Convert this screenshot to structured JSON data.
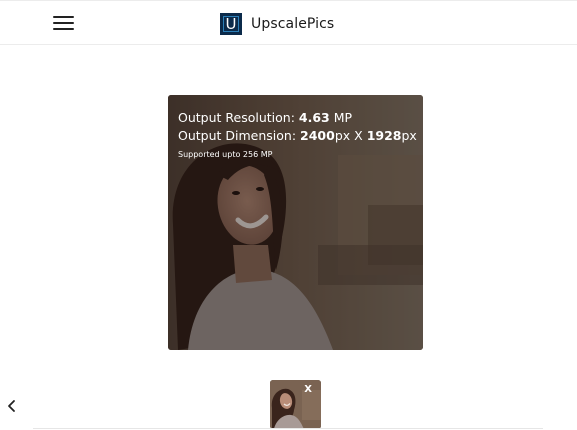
{
  "header": {
    "brand_letter": "U",
    "brand_name": "UpscalePics",
    "menu_icon": "hamburger-menu-icon"
  },
  "preview": {
    "resolution_label": "Output Resolution: ",
    "resolution_value": "4.63",
    "resolution_unit": " MP",
    "dimension_label": "Output Dimension: ",
    "width_value": "2400",
    "width_unit": "px",
    "separator": " X ",
    "height_value": "1928",
    "height_unit": "px",
    "supported_text": "Supported upto 256 MP"
  },
  "thumbnail": {
    "close_label": "X"
  },
  "navigation": {
    "prev_icon": "chevron-left-icon"
  },
  "colors": {
    "logo_bg": "#0b2a4a",
    "logo_accent": "#2b7fb8",
    "overlay_text": "#ffffff"
  }
}
